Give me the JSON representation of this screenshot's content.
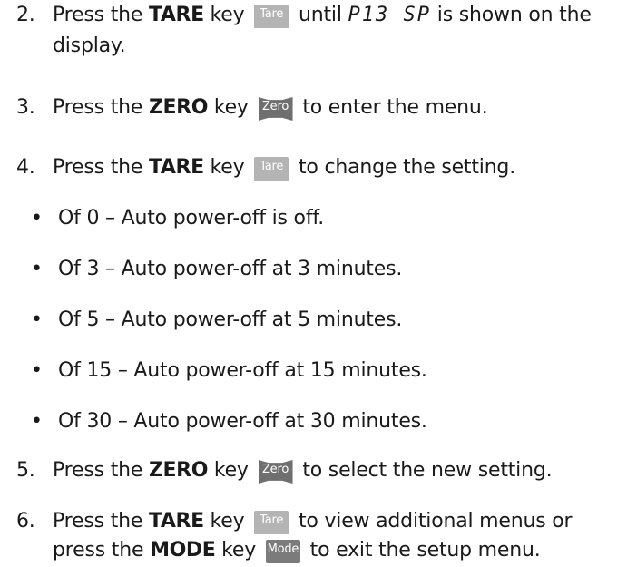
{
  "steps": {
    "s2": {
      "num": "2.",
      "t1": "Press the ",
      "k1": "TARE",
      "t2": " key ",
      "key": "Tare",
      "t3": " until ",
      "seg": "P13 SP",
      "t4": " is shown on the",
      "l2": "display."
    },
    "s3": {
      "num": "3.",
      "t1": "Press the ",
      "k1": "ZERO",
      "t2": " key ",
      "key": "Zero",
      "t3": " to enter the menu."
    },
    "s4": {
      "num": "4.",
      "t1": "Press the ",
      "k1": "TARE",
      "t2": " key ",
      "key": "Tare",
      "t3": " to change the setting."
    },
    "s5": {
      "num": "5.",
      "t1": "Press the ",
      "k1": "ZERO",
      "t2": " key ",
      "key": "Zero",
      "t3": " to select the new setting."
    },
    "s6": {
      "num": "6.",
      "t1": "Press the ",
      "k1": "TARE",
      "t2": " key ",
      "key": "Tare",
      "t3": " to view additional menus or",
      "l2a": "press the ",
      "k2": "MODE",
      "l2b": " key ",
      "key2": "Mode",
      "l2c": " to exit the setup menu."
    }
  },
  "bullets": [
    {
      "mark": "•",
      "text": "Of  0 – Auto power-off is off."
    },
    {
      "mark": "•",
      "text": "Of  3 – Auto power-off at 3 minutes."
    },
    {
      "mark": "•",
      "text": "Of  5 – Auto power-off at 5 minutes."
    },
    {
      "mark": "•",
      "text": "Of  15 – Auto power-off at 15 minutes."
    },
    {
      "mark": "•",
      "text": "Of  30 – Auto power-off at 30 minutes."
    }
  ]
}
